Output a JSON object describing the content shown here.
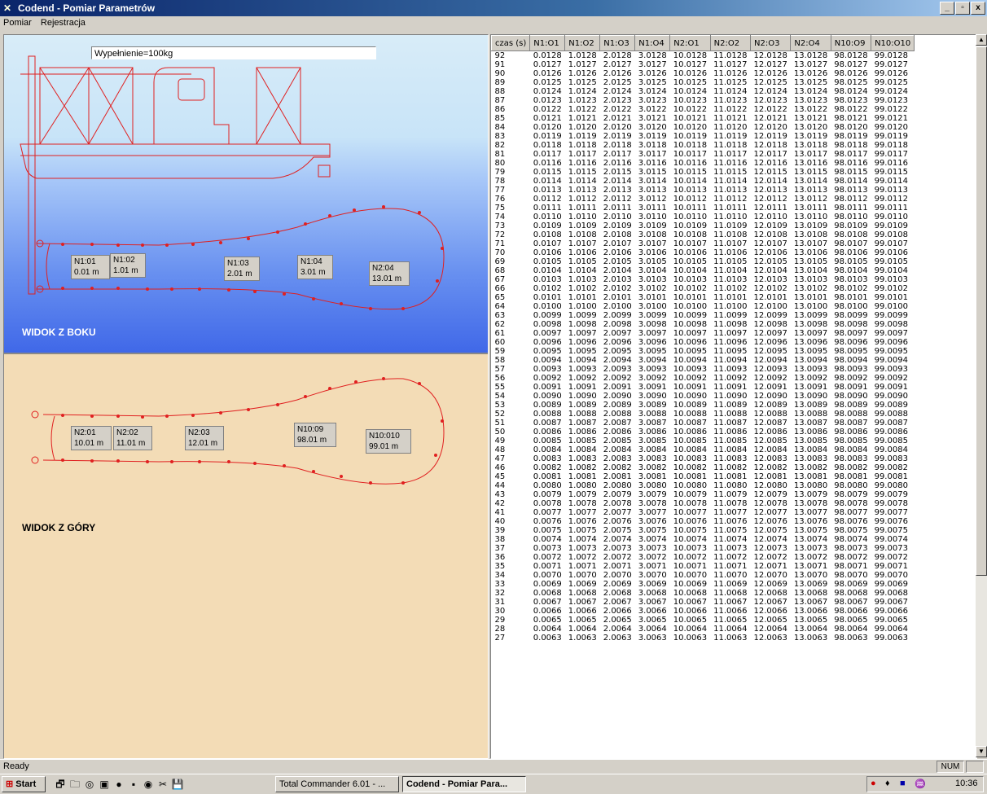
{
  "window": {
    "title": "Codend - Pomiar Parametrów",
    "buttons": [
      "_",
      "▫",
      "x"
    ]
  },
  "menu": [
    "Pomiar",
    "Rejestracja"
  ],
  "side_view": {
    "fill_text": "Wypełnienie=100kg",
    "label": "WIDOK Z BOKU",
    "sensors": [
      {
        "name": "N1:01",
        "value": "0.01 m"
      },
      {
        "name": "N1:02",
        "value": "1.01 m"
      },
      {
        "name": "N1:03",
        "value": "2.01 m"
      },
      {
        "name": "N1:04",
        "value": "3.01 m"
      },
      {
        "name": "N2:04",
        "value": "13.01 m"
      }
    ]
  },
  "top_view": {
    "label": "WIDOK Z GÓRY",
    "sensors": [
      {
        "name": "N2:01",
        "value": "10.01 m"
      },
      {
        "name": "N2:02",
        "value": "11.01 m"
      },
      {
        "name": "N2:03",
        "value": "12.01 m"
      },
      {
        "name": "N10:09",
        "value": "98.01 m"
      },
      {
        "name": "N10:010",
        "value": "99.01 m"
      }
    ]
  },
  "table": {
    "headers": [
      "czas (s)",
      "N1:O1",
      "N1:O2",
      "N1:O3",
      "N1:O4",
      "N2:O1",
      "N2:O2",
      "N2:O3",
      "N2:O4",
      "N10:O9",
      "N10:O10"
    ],
    "offsets": [
      0,
      1,
      2,
      3,
      10,
      11,
      12,
      13,
      98,
      99
    ],
    "time_start": 92,
    "time_end": 27
  },
  "status": {
    "text": "Ready",
    "num": "NUM"
  },
  "taskbar": {
    "start": "Start",
    "tasks": [
      "Total Commander 6.01 - ...",
      "Codend - Pomiar Para..."
    ],
    "clock": "10:36"
  }
}
